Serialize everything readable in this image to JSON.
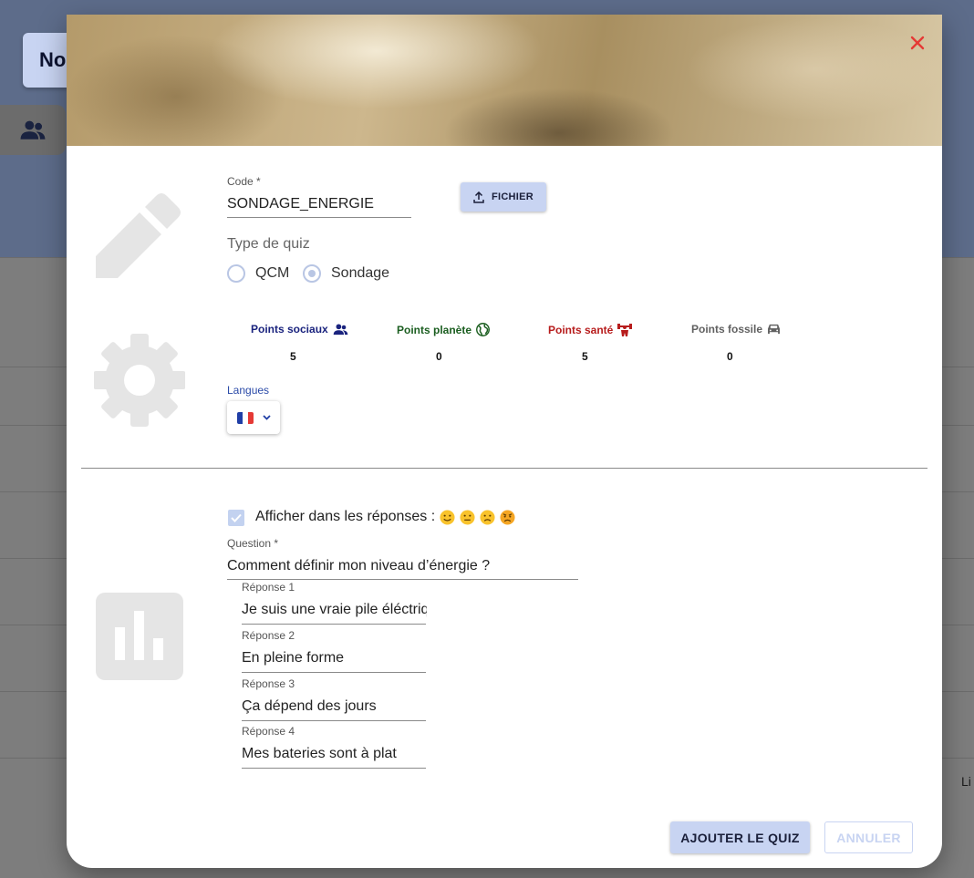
{
  "background": {
    "title": "Nouveau quiz",
    "edge_text": "Li"
  },
  "modal": {
    "code": {
      "label": "Code *",
      "value": "SONDAGE_ENERGIE"
    },
    "file_button": "FICHIER",
    "quiz_type": {
      "label": "Type de quiz",
      "options": [
        "QCM",
        "Sondage"
      ],
      "selected": "Sondage"
    },
    "points": [
      {
        "label": "Points sociaux",
        "value": "5",
        "color": "#1a237e",
        "icon": "people-icon"
      },
      {
        "label": "Points planète",
        "value": "0",
        "color": "#1b5e20",
        "icon": "globe-icon"
      },
      {
        "label": "Points santé",
        "value": "5",
        "color": "#b71c1c",
        "icon": "muscle-icon"
      },
      {
        "label": "Points fossile",
        "value": "0",
        "color": "#616161",
        "icon": "car-icon"
      }
    ],
    "languages": {
      "label": "Langues",
      "selected": "fr",
      "flag_icon": "france-flag-icon"
    },
    "show_in_answers": {
      "label": "Afficher dans les réponses :",
      "checked": true,
      "emojis": [
        "smile-emoji",
        "neutral-emoji",
        "frown-emoji",
        "angry-emoji"
      ]
    },
    "question": {
      "label": "Question *",
      "value": "Comment définir mon niveau d’énergie ?"
    },
    "answers": [
      {
        "label": "Réponse 1",
        "value": "Je suis une vraie pile éléctrique"
      },
      {
        "label": "Réponse 2",
        "value": "En pleine forme"
      },
      {
        "label": "Réponse 3",
        "value": "Ça dépend des jours"
      },
      {
        "label": "Réponse 4",
        "value": "Mes bateries sont à plat"
      }
    ],
    "buttons": {
      "add": "AJOUTER LE QUIZ",
      "cancel": "ANNULER"
    }
  },
  "colors": {
    "accent": "#c8d4f2",
    "close": "#e53935"
  }
}
